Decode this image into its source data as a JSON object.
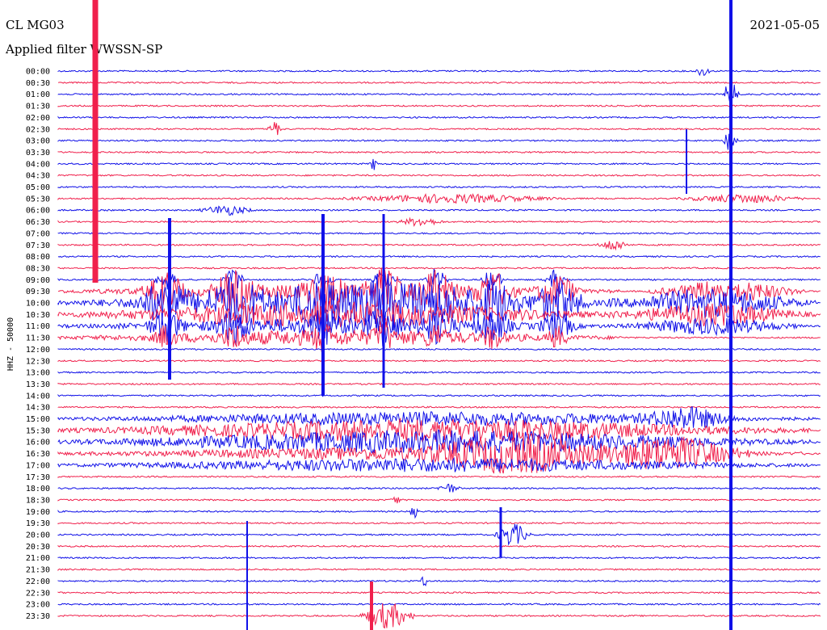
{
  "header": {
    "station": "CL MG03",
    "filter": "Applied filter WWSSN-SP",
    "date": "2021-05-05"
  },
  "colors": {
    "trace_a": "#1010e8",
    "trace_b": "#f0204c",
    "text": "#000000",
    "background": "#ffffff"
  },
  "chart_data": {
    "type": "line",
    "title": "CL MG03",
    "subtitle": "Applied filter WWSSN-SP",
    "date": "2021-05-05",
    "ylabel": "HHZ - 50000",
    "xlabel": "",
    "grid": false,
    "rows": [
      {
        "label": "00:00",
        "color": "blue"
      },
      {
        "label": "00:30",
        "color": "red"
      },
      {
        "label": "01:00",
        "color": "blue"
      },
      {
        "label": "01:30",
        "color": "red"
      },
      {
        "label": "02:00",
        "color": "blue"
      },
      {
        "label": "02:30",
        "color": "red"
      },
      {
        "label": "03:00",
        "color": "blue"
      },
      {
        "label": "03:30",
        "color": "red"
      },
      {
        "label": "04:00",
        "color": "blue"
      },
      {
        "label": "04:30",
        "color": "red"
      },
      {
        "label": "05:00",
        "color": "blue"
      },
      {
        "label": "05:30",
        "color": "red"
      },
      {
        "label": "06:00",
        "color": "blue"
      },
      {
        "label": "06:30",
        "color": "red"
      },
      {
        "label": "07:00",
        "color": "blue"
      },
      {
        "label": "07:30",
        "color": "red"
      },
      {
        "label": "08:00",
        "color": "blue"
      },
      {
        "label": "08:30",
        "color": "red"
      },
      {
        "label": "09:00",
        "color": "blue"
      },
      {
        "label": "09:30",
        "color": "red"
      },
      {
        "label": "10:00",
        "color": "blue"
      },
      {
        "label": "10:30",
        "color": "red"
      },
      {
        "label": "11:00",
        "color": "blue"
      },
      {
        "label": "11:30",
        "color": "red"
      },
      {
        "label": "12:00",
        "color": "blue"
      },
      {
        "label": "12:30",
        "color": "red"
      },
      {
        "label": "13:00",
        "color": "blue"
      },
      {
        "label": "13:30",
        "color": "red"
      },
      {
        "label": "14:00",
        "color": "blue"
      },
      {
        "label": "14:30",
        "color": "red"
      },
      {
        "label": "15:00",
        "color": "blue"
      },
      {
        "label": "15:30",
        "color": "red"
      },
      {
        "label": "16:00",
        "color": "blue"
      },
      {
        "label": "16:30",
        "color": "red"
      },
      {
        "label": "17:00",
        "color": "blue"
      },
      {
        "label": "17:30",
        "color": "red"
      },
      {
        "label": "18:00",
        "color": "blue"
      },
      {
        "label": "18:30",
        "color": "red"
      },
      {
        "label": "19:00",
        "color": "blue"
      },
      {
        "label": "19:30",
        "color": "red"
      },
      {
        "label": "20:00",
        "color": "blue"
      },
      {
        "label": "20:30",
        "color": "red"
      },
      {
        "label": "21:00",
        "color": "blue"
      },
      {
        "label": "21:30",
        "color": "red"
      },
      {
        "label": "22:00",
        "color": "blue"
      },
      {
        "label": "22:30",
        "color": "red"
      },
      {
        "label": "23:00",
        "color": "blue"
      },
      {
        "label": "23:30",
        "color": "red"
      }
    ]
  }
}
